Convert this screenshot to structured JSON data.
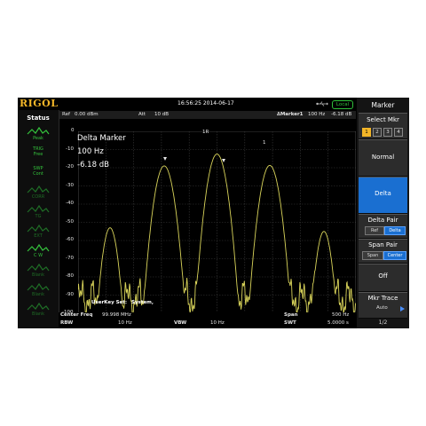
{
  "topbar": {
    "logo": "RIGOL",
    "datetime": "16:56:25 2014-06-17",
    "usb_icon": "usb-icon",
    "local_label": "Local"
  },
  "header": {
    "ref_label": "Ref",
    "ref_value": "0.00 dBm",
    "att_label": "Att",
    "att_value": "10 dB",
    "marker_label": "∆Marker1",
    "marker_freq": "100 Hz",
    "marker_value": "-6.18 dB"
  },
  "status": {
    "title": "Status",
    "items": [
      {
        "label": "Peak",
        "icon": "peak-detector-icon",
        "dim": false
      },
      {
        "label": "TRIG\nFree",
        "icon": "",
        "dim": false
      },
      {
        "label": "SWP\nCont",
        "icon": "",
        "dim": false
      },
      {
        "label": "CORR",
        "icon": "corr-icon",
        "dim": true
      },
      {
        "label": "TG",
        "icon": "tg-icon",
        "dim": true
      },
      {
        "label": "EXT",
        "icon": "ext-icon",
        "dim": true
      },
      {
        "label": "C W",
        "icon": "clear-write-icon",
        "dim": false
      },
      {
        "label": "Blank",
        "icon": "blank-icon",
        "dim": true
      },
      {
        "label": "Blank",
        "icon": "blank-icon",
        "dim": true
      },
      {
        "label": "Blank",
        "icon": "blank-icon",
        "dim": true
      }
    ]
  },
  "graph": {
    "y_labels": [
      "0",
      "-10",
      "-20",
      "-30",
      "-40",
      "-50",
      "-60",
      "-70",
      "-80",
      "-90",
      "-100"
    ],
    "annotation_title": "Delta Marker",
    "annotation_freq": "100 Hz",
    "annotation_value": "-6.18 dB",
    "ref_marker_label": "1R",
    "delta_marker_label": "1",
    "userkey_label": "UserKey Set:",
    "userkey_value": "System,",
    "trace_color": "#d9d45a"
  },
  "bottom": {
    "center_label": "Center Freq",
    "center_value": "99.998 MHz",
    "span_label": "Span",
    "span_value": "500 Hz",
    "rbw_label": "RBW",
    "rbw_value": "10 Hz",
    "vbw_label": "VBW",
    "vbw_value": "10 Hz",
    "swt_label": "SWT",
    "swt_value": "5.0000 s"
  },
  "menu": {
    "title": "Marker",
    "select_mkr_label": "Select Mkr",
    "select_mkr_options": [
      "1",
      "2",
      "3",
      "4"
    ],
    "select_mkr_active": 0,
    "normal_label": "Normal",
    "delta_label": "Delta",
    "delta_pair_label": "Delta Pair",
    "delta_pair_options": [
      "Ref",
      "Delta"
    ],
    "span_pair_label": "Span Pair",
    "span_pair_options": [
      "Span",
      "Center"
    ],
    "off_label": "Off",
    "mkr_trace_label": "Mkr Trace",
    "mkr_trace_value": "Auto",
    "page_indicator": "1/2",
    "accent_color": "#1a6fd1"
  }
}
